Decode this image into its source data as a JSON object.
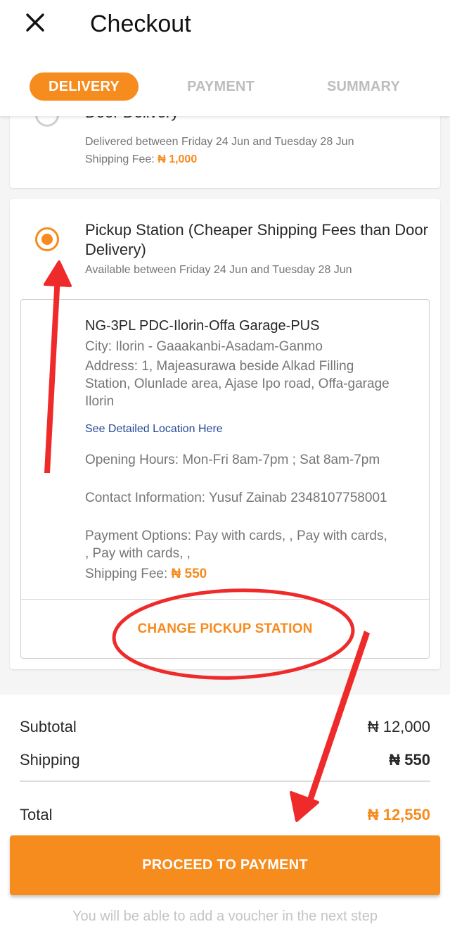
{
  "header": {
    "title": "Checkout",
    "tabs": [
      {
        "label": "DELIVERY",
        "active": true
      },
      {
        "label": "PAYMENT",
        "active": false
      },
      {
        "label": "SUMMARY",
        "active": false
      }
    ]
  },
  "door_delivery": {
    "title": "Door Delivery",
    "window": "Delivered between Friday 24 Jun and Tuesday 28 Jun",
    "fee_label": "Shipping Fee: ",
    "fee_value": "₦ 1,000",
    "selected": false
  },
  "pickup": {
    "title": "Pickup Station (Cheaper Shipping Fees than Door Delivery)",
    "window": "Available between Friday 24 Jun and Tuesday 28 Jun",
    "selected": true,
    "station": {
      "name": "NG-3PL PDC-Ilorin-Offa Garage-PUS",
      "city": "City: Ilorin - Gaaakanbi-Asadam-Ganmo",
      "address": "Address: 1, Majeasurawa beside Alkad Filling Station, Olunlade area, Ajase Ipo road, Offa-garage Ilorin",
      "location_link": "See Detailed Location Here",
      "hours": "Opening Hours: Mon-Fri 8am-7pm ; Sat 8am-7pm",
      "contact": "Contact Information: Yusuf Zainab 2348107758001",
      "payment_options": "Payment Options: Pay with cards, , Pay with cards, , Pay with cards, ,",
      "fee_label": "Shipping Fee: ",
      "fee_value": "₦ 550"
    },
    "change_label": "CHANGE PICKUP STATION"
  },
  "summary": {
    "subtotal_label": "Subtotal",
    "subtotal_value": "₦ 12,000",
    "shipping_label": "Shipping",
    "shipping_value": "₦ 550",
    "total_label": "Total",
    "total_value": "₦ 12,550",
    "proceed_label": "PROCEED TO PAYMENT",
    "voucher_note": "You will be able to add a voucher in the next step"
  },
  "colors": {
    "accent": "#f68b1e",
    "annotation": "#ee2a2a",
    "link": "#264996"
  },
  "icons": {
    "close": "close-icon"
  }
}
